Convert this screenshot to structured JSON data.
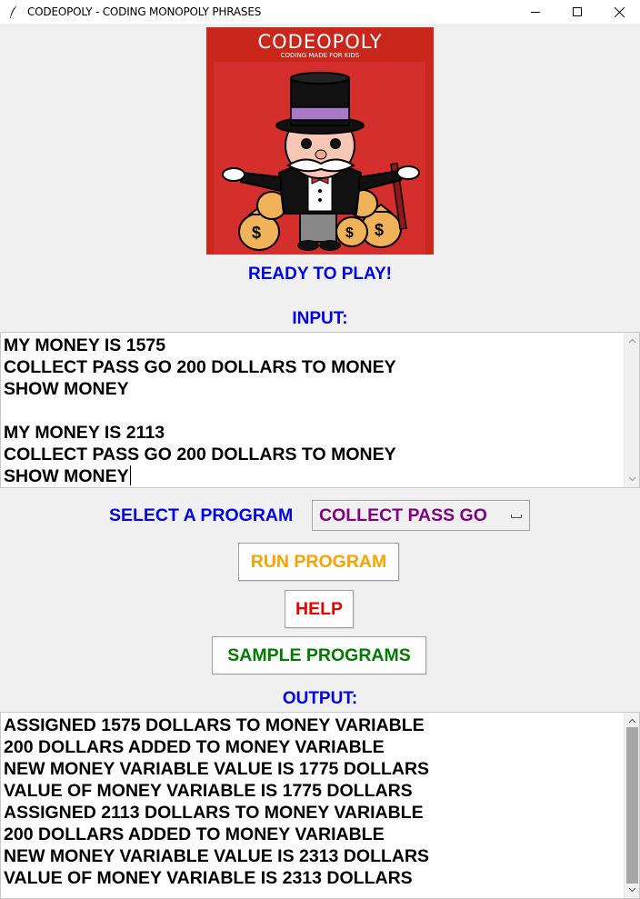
{
  "window": {
    "title": "CODEOPOLY - CODING MONOPOLY PHRASES",
    "icon": "feather-icon"
  },
  "logo": {
    "title": "CODEOPOLY",
    "subtitle": "CODING MADE FOR KIDS"
  },
  "status": "READY TO PLAY!",
  "input": {
    "label": "INPUT:",
    "lines": [
      "MY MONEY IS 1575",
      "COLLECT PASS GO 200 DOLLARS TO MONEY",
      "SHOW MONEY",
      "",
      "MY MONEY IS 2113",
      "COLLECT PASS GO 200 DOLLARS TO MONEY",
      "SHOW MONEY"
    ]
  },
  "program_select": {
    "label": "SELECT A PROGRAM",
    "selected": "COLLECT PASS GO"
  },
  "buttons": {
    "run": "RUN PROGRAM",
    "help": "HELP",
    "samples": "SAMPLE PROGRAMS"
  },
  "output": {
    "label": "OUTPUT:",
    "lines": [
      "ASSIGNED 1575 DOLLARS TO MONEY VARIABLE",
      "200 DOLLARS ADDED TO MONEY VARIABLE",
      "NEW MONEY VARIABLE VALUE IS 1775 DOLLARS",
      "VALUE OF MONEY VARIABLE IS 1775 DOLLARS",
      "ASSIGNED 2113 DOLLARS TO MONEY VARIABLE",
      "200 DOLLARS ADDED TO MONEY VARIABLE",
      "NEW MONEY VARIABLE VALUE IS 2313 DOLLARS",
      "VALUE OF MONEY VARIABLE IS 2313 DOLLARS"
    ]
  },
  "colors": {
    "label_blue": "#0000e6",
    "select_purple": "#800080",
    "run_orange": "#f4a300",
    "help_red": "#e60000",
    "sample_green": "#007a00",
    "logo_red": "#c9271b"
  }
}
